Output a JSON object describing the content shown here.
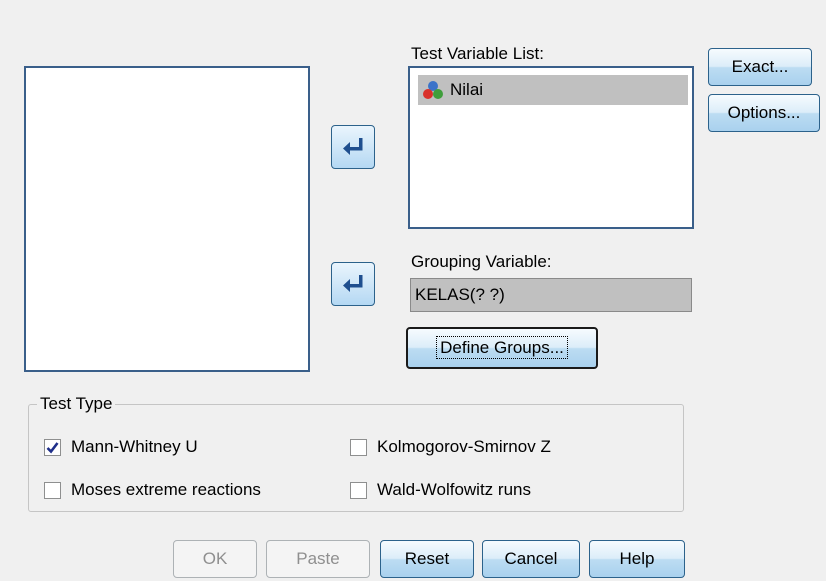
{
  "test_variable_list": {
    "label": "Test Variable List:",
    "items": [
      {
        "name": "Nilai",
        "icon": "nominal-variable-icon"
      }
    ]
  },
  "grouping_variable": {
    "label": "Grouping Variable:",
    "value": "KELAS(? ?)"
  },
  "side_buttons": {
    "exact": "Exact...",
    "options": "Options..."
  },
  "define_groups": "Define Groups...",
  "test_type": {
    "legend": "Test Type",
    "options": [
      {
        "label": "Mann-Whitney U",
        "checked": true
      },
      {
        "label": "Kolmogorov-Smirnov Z",
        "checked": false
      },
      {
        "label": "Moses extreme reactions",
        "checked": false
      },
      {
        "label": "Wald-Wolfowitz runs",
        "checked": false
      }
    ]
  },
  "bottom_buttons": {
    "ok": "OK",
    "paste": "Paste",
    "reset": "Reset",
    "cancel": "Cancel",
    "help": "Help"
  },
  "colors": {
    "button_border": "#2c628b",
    "listbox_border": "#3a5f8a",
    "selection": "#c0c0c0",
    "arrow": "#1f4f8f"
  }
}
